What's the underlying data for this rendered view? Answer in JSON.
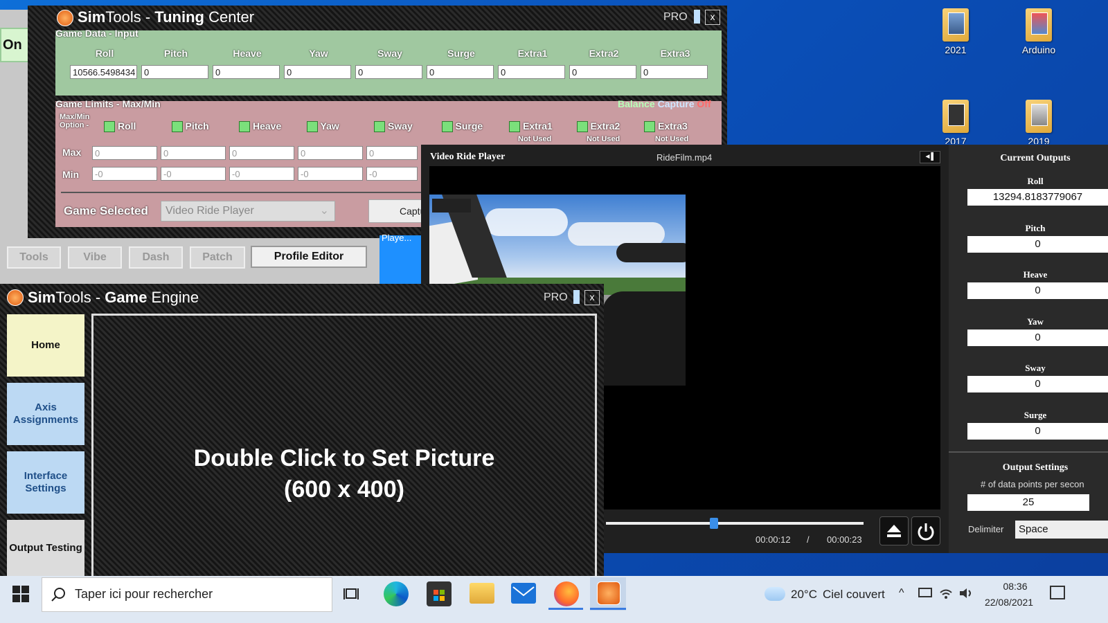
{
  "desktop": {
    "icons": [
      {
        "label": "2021"
      },
      {
        "label": "Arduino"
      },
      {
        "label": "2017"
      },
      {
        "label": "2019"
      }
    ]
  },
  "left_toggle": {
    "label": "On"
  },
  "tuning_center": {
    "title_a": "Sim",
    "title_b": "Tools - ",
    "title_c": "Tuning",
    "title_d": " Center",
    "pro": "PRO",
    "close": "x",
    "game_data_label": "Game Data - Input",
    "columns": [
      "Roll",
      "Pitch",
      "Heave",
      "Yaw",
      "Sway",
      "Surge",
      "Extra1",
      "Extra2",
      "Extra3"
    ],
    "input_values": [
      "10566.5498434",
      "0",
      "0",
      "0",
      "0",
      "0",
      "0",
      "0",
      "0"
    ],
    "limits_label": "Game Limits - Max/Min",
    "balance": "Balance",
    "capture": "Capture",
    "capture_state": "Off",
    "maxmin_option": "Max/Min Option -",
    "options": [
      "Roll",
      "Pitch",
      "Heave",
      "Yaw",
      "Sway",
      "Surge",
      "Extra1",
      "Extra2",
      "Extra3"
    ],
    "not_used": [
      "Not Used",
      "Not Used",
      "Not Used"
    ],
    "max_label": "Max",
    "min_label": "Min",
    "max_values": [
      "0",
      "0",
      "0",
      "0",
      "0"
    ],
    "min_values": [
      "-0",
      "-0",
      "-0",
      "-0",
      "-0"
    ],
    "game_selected_label": "Game Selected",
    "game_selected_value": "Video Ride Player",
    "capture_btn": "Captu",
    "tabs": [
      "Tools",
      "Vibe",
      "Dash",
      "Patch",
      "Profile Editor"
    ],
    "player_hint": "Playe..."
  },
  "video_player": {
    "title": "Video Ride Player",
    "file": "RideFilm.mp4",
    "time_current": "00:00:12",
    "time_sep": "/",
    "time_total": "00:00:23",
    "progress": 0.42
  },
  "current_outputs": {
    "title": "Current Outputs",
    "items": [
      {
        "label": "Roll",
        "value": "13294.8183779067"
      },
      {
        "label": "Pitch",
        "value": "0"
      },
      {
        "label": "Heave",
        "value": "0"
      },
      {
        "label": "Yaw",
        "value": "0"
      },
      {
        "label": "Sway",
        "value": "0"
      },
      {
        "label": "Surge",
        "value": "0"
      }
    ],
    "settings_title": "Output Settings",
    "datapoints_label": "# of data points per secon",
    "datapoints_value": "25",
    "delimiter_label": "Delimiter",
    "delimiter_value": "Space"
  },
  "game_engine": {
    "title_a": "Sim",
    "title_b": "Tools - ",
    "title_c": "Game",
    "title_d": " Engine",
    "pro": "PRO",
    "close": "x",
    "side_buttons": [
      "Home",
      "Axis Assignments",
      "Interface Settings",
      "Output Testing"
    ],
    "picture_line1": "Double Click to Set Picture",
    "picture_line2": "(600 x 400)"
  },
  "taskbar": {
    "search_placeholder": "Taper ici pour rechercher",
    "weather_temp": "20°C",
    "weather_desc": "Ciel couvert",
    "time": "08:36",
    "date": "22/08/2021"
  }
}
